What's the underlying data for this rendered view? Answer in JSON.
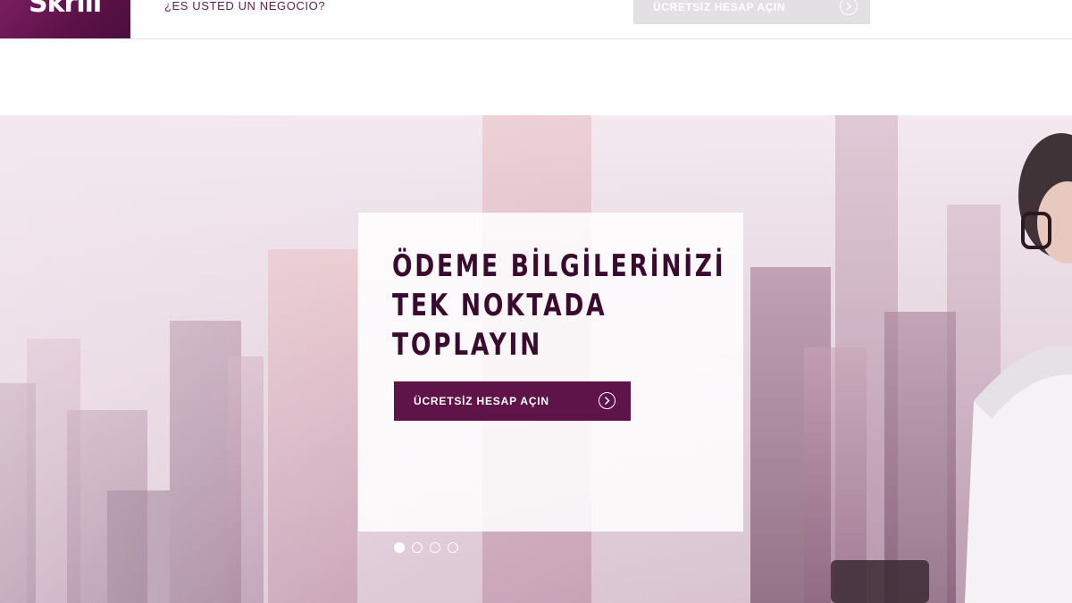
{
  "header": {
    "logo_text": "Skrill",
    "business_link": "¿ES USTED UN NEGOCIO?",
    "cta_label": "ÜCRETSİZ HESAP AÇIN"
  },
  "hero": {
    "headline_lines": [
      "ÖDEME BİLGİLERİNİZİ",
      "TEK NOKTADA",
      "TOPLAYIN"
    ],
    "cta_label": "ÜCRETSİZ HESAP AÇIN",
    "slides": {
      "count": 4,
      "active": 1
    }
  },
  "icons": {
    "cta_arrow": "chevron-right-circle-icon",
    "top_cta_arrow": "chevron-right-circle-icon"
  },
  "colors": {
    "brand": "#5e1449",
    "headline": "#3a0b2f",
    "top_cta_bg": "#e3e0e3"
  }
}
